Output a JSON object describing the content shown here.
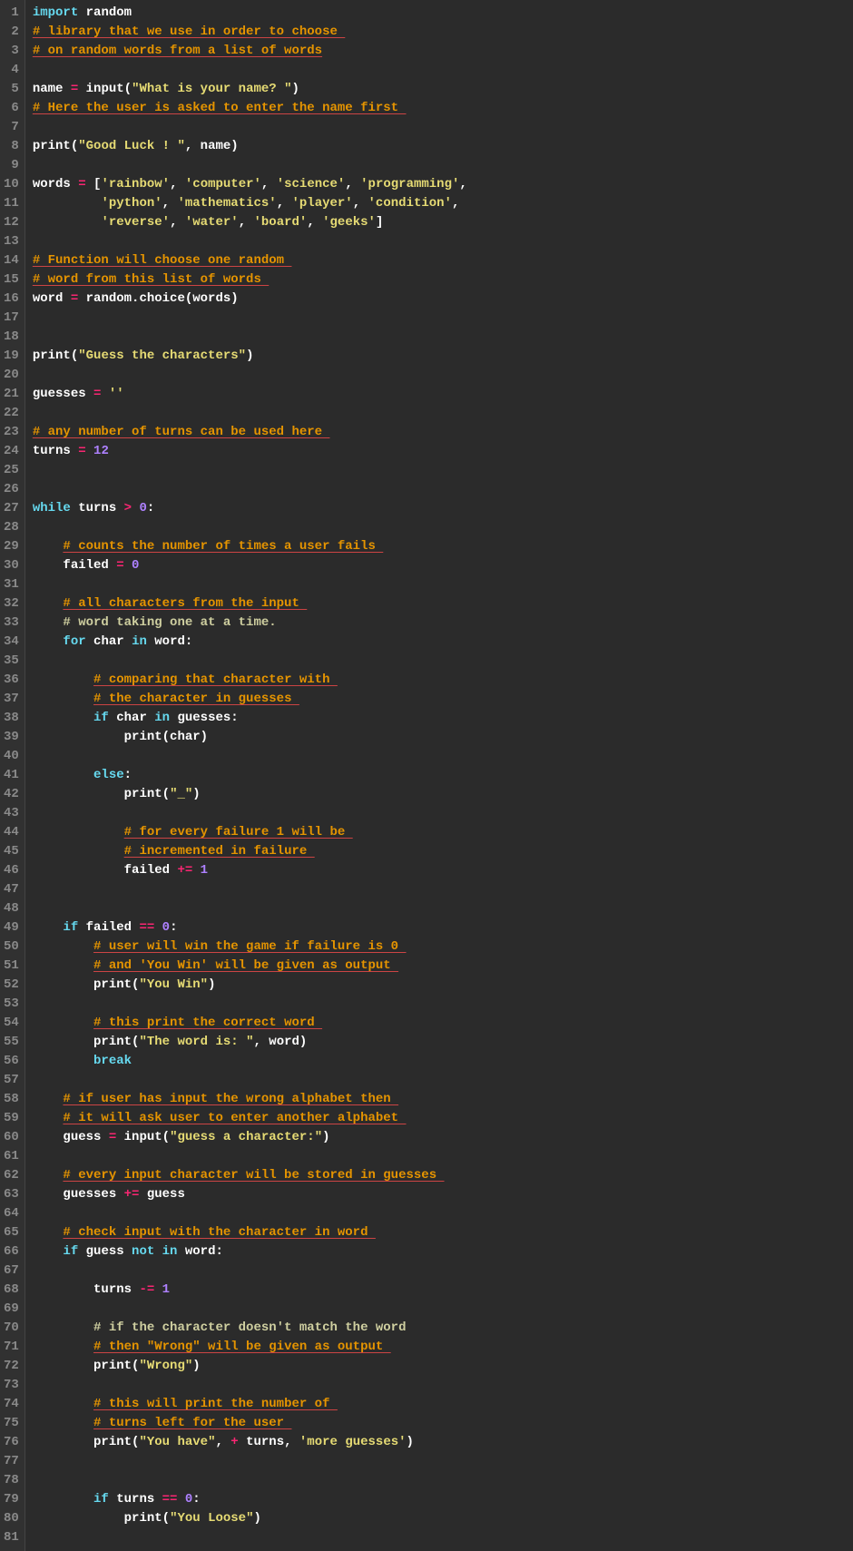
{
  "chart_data": null,
  "file": {
    "language": "python",
    "lines": [
      [
        [
          "kw",
          "import"
        ],
        [
          "nm",
          " random"
        ]
      ],
      [
        [
          "sp",
          "# library that we use in order to choose "
        ]
      ],
      [
        [
          "sp",
          "# on random words from a list of words"
        ]
      ],
      [],
      [
        [
          "nm",
          "name "
        ],
        [
          "op",
          "="
        ],
        [
          "nm",
          " "
        ],
        [
          "fn",
          "input"
        ],
        [
          "nm",
          "("
        ],
        [
          "str",
          "\"What is your name? \""
        ],
        [
          "nm",
          ")"
        ]
      ],
      [
        [
          "sp",
          "# Here the user is asked to enter the name first "
        ]
      ],
      [],
      [
        [
          "fn",
          "print"
        ],
        [
          "nm",
          "("
        ],
        [
          "str",
          "\"Good Luck ! \""
        ],
        [
          "nm",
          ", name)"
        ]
      ],
      [],
      [
        [
          "nm",
          "words "
        ],
        [
          "op",
          "="
        ],
        [
          "nm",
          " ["
        ],
        [
          "str",
          "'rainbow'"
        ],
        [
          "nm",
          ", "
        ],
        [
          "str",
          "'computer'"
        ],
        [
          "nm",
          ", "
        ],
        [
          "str",
          "'science'"
        ],
        [
          "nm",
          ", "
        ],
        [
          "str",
          "'programming'"
        ],
        [
          "nm",
          ", "
        ]
      ],
      [
        [
          "nm",
          "         "
        ],
        [
          "str",
          "'python'"
        ],
        [
          "nm",
          ", "
        ],
        [
          "str",
          "'mathematics'"
        ],
        [
          "nm",
          ", "
        ],
        [
          "str",
          "'player'"
        ],
        [
          "nm",
          ", "
        ],
        [
          "str",
          "'condition'"
        ],
        [
          "nm",
          ", "
        ]
      ],
      [
        [
          "nm",
          "         "
        ],
        [
          "str",
          "'reverse'"
        ],
        [
          "nm",
          ", "
        ],
        [
          "str",
          "'water'"
        ],
        [
          "nm",
          ", "
        ],
        [
          "str",
          "'board'"
        ],
        [
          "nm",
          ", "
        ],
        [
          "str",
          "'geeks'"
        ],
        [
          "nm",
          "] "
        ]
      ],
      [],
      [
        [
          "sp",
          "# Function will choose one random "
        ]
      ],
      [
        [
          "sp",
          "# word from this list of words "
        ]
      ],
      [
        [
          "nm",
          "word "
        ],
        [
          "op",
          "="
        ],
        [
          "nm",
          " random.choice(words) "
        ]
      ],
      [],
      [],
      [
        [
          "fn",
          "print"
        ],
        [
          "nm",
          "("
        ],
        [
          "str",
          "\"Guess the characters\""
        ],
        [
          "nm",
          ") "
        ]
      ],
      [],
      [
        [
          "nm",
          "guesses "
        ],
        [
          "op",
          "="
        ],
        [
          "nm",
          " "
        ],
        [
          "str",
          "''"
        ]
      ],
      [],
      [
        [
          "sp",
          "# any number of turns can be used here "
        ]
      ],
      [
        [
          "nm",
          "turns "
        ],
        [
          "op",
          "="
        ],
        [
          "nm",
          " "
        ],
        [
          "num",
          "12"
        ]
      ],
      [],
      [],
      [
        [
          "kw",
          "while"
        ],
        [
          "nm",
          " turns "
        ],
        [
          "op",
          ">"
        ],
        [
          "nm",
          " "
        ],
        [
          "num",
          "0"
        ],
        [
          "nm",
          ": "
        ]
      ],
      [],
      [
        [
          "nm",
          "    "
        ],
        [
          "sp",
          "# counts the number of times a user fails "
        ]
      ],
      [
        [
          "nm",
          "    failed "
        ],
        [
          "op",
          "="
        ],
        [
          "nm",
          " "
        ],
        [
          "num",
          "0"
        ]
      ],
      [],
      [
        [
          "nm",
          "    "
        ],
        [
          "sp",
          "# all characters from the input "
        ]
      ],
      [
        [
          "nm",
          "    "
        ],
        [
          "cmt",
          "# word taking one at a time. "
        ]
      ],
      [
        [
          "nm",
          "    "
        ],
        [
          "kw",
          "for"
        ],
        [
          "nm",
          " char "
        ],
        [
          "kw",
          "in"
        ],
        [
          "nm",
          " word: "
        ]
      ],
      [],
      [
        [
          "nm",
          "        "
        ],
        [
          "sp",
          "# comparing that character with "
        ]
      ],
      [
        [
          "nm",
          "        "
        ],
        [
          "sp",
          "# the character in guesses "
        ]
      ],
      [
        [
          "nm",
          "        "
        ],
        [
          "kw",
          "if"
        ],
        [
          "nm",
          " char "
        ],
        [
          "kw",
          "in"
        ],
        [
          "nm",
          " guesses: "
        ]
      ],
      [
        [
          "nm",
          "            "
        ],
        [
          "fn",
          "print"
        ],
        [
          "nm",
          "(char) "
        ]
      ],
      [],
      [
        [
          "nm",
          "        "
        ],
        [
          "kw",
          "else"
        ],
        [
          "nm",
          ": "
        ]
      ],
      [
        [
          "nm",
          "            "
        ],
        [
          "fn",
          "print"
        ],
        [
          "nm",
          "("
        ],
        [
          "str",
          "\"_\""
        ],
        [
          "nm",
          ") "
        ]
      ],
      [],
      [
        [
          "nm",
          "            "
        ],
        [
          "sp",
          "# for every failure 1 will be "
        ]
      ],
      [
        [
          "nm",
          "            "
        ],
        [
          "sp",
          "# incremented in failure "
        ]
      ],
      [
        [
          "nm",
          "            failed "
        ],
        [
          "op",
          "+="
        ],
        [
          "nm",
          " "
        ],
        [
          "num",
          "1"
        ]
      ],
      [],
      [],
      [
        [
          "nm",
          "    "
        ],
        [
          "kw",
          "if"
        ],
        [
          "nm",
          " failed "
        ],
        [
          "op",
          "=="
        ],
        [
          "nm",
          " "
        ],
        [
          "num",
          "0"
        ],
        [
          "nm",
          ": "
        ]
      ],
      [
        [
          "nm",
          "        "
        ],
        [
          "sp",
          "# user will win the game if failure is 0 "
        ]
      ],
      [
        [
          "nm",
          "        "
        ],
        [
          "sp",
          "# and 'You Win' will be given as output "
        ]
      ],
      [
        [
          "nm",
          "        "
        ],
        [
          "fn",
          "print"
        ],
        [
          "nm",
          "("
        ],
        [
          "str",
          "\"You Win\""
        ],
        [
          "nm",
          ") "
        ]
      ],
      [],
      [
        [
          "nm",
          "        "
        ],
        [
          "sp",
          "# this print the correct word "
        ]
      ],
      [
        [
          "nm",
          "        "
        ],
        [
          "fn",
          "print"
        ],
        [
          "nm",
          "("
        ],
        [
          "str",
          "\"The word is: \""
        ],
        [
          "nm",
          ", word) "
        ]
      ],
      [
        [
          "nm",
          "        "
        ],
        [
          "kw",
          "break"
        ]
      ],
      [],
      [
        [
          "nm",
          "    "
        ],
        [
          "sp",
          "# if user has input the wrong alphabet then "
        ]
      ],
      [
        [
          "nm",
          "    "
        ],
        [
          "sp",
          "# it will ask user to enter another alphabet "
        ]
      ],
      [
        [
          "nm",
          "    guess "
        ],
        [
          "op",
          "="
        ],
        [
          "nm",
          " "
        ],
        [
          "fn",
          "input"
        ],
        [
          "nm",
          "("
        ],
        [
          "str",
          "\"guess a character:\""
        ],
        [
          "nm",
          ") "
        ]
      ],
      [],
      [
        [
          "nm",
          "    "
        ],
        [
          "sp",
          "# every input character will be stored in guesses "
        ]
      ],
      [
        [
          "nm",
          "    guesses "
        ],
        [
          "op",
          "+="
        ],
        [
          "nm",
          " guess "
        ]
      ],
      [],
      [
        [
          "nm",
          "    "
        ],
        [
          "sp",
          "# check input with the character in word "
        ]
      ],
      [
        [
          "nm",
          "    "
        ],
        [
          "kw",
          "if"
        ],
        [
          "nm",
          " guess "
        ],
        [
          "kw",
          "not in"
        ],
        [
          "nm",
          " word: "
        ]
      ],
      [],
      [
        [
          "nm",
          "        turns "
        ],
        [
          "op",
          "-="
        ],
        [
          "nm",
          " "
        ],
        [
          "num",
          "1"
        ]
      ],
      [],
      [
        [
          "nm",
          "        "
        ],
        [
          "cmt",
          "# if the character doesn't match the word "
        ]
      ],
      [
        [
          "nm",
          "        "
        ],
        [
          "sp",
          "# then \"Wrong\" will be given as output "
        ]
      ],
      [
        [
          "nm",
          "        "
        ],
        [
          "fn",
          "print"
        ],
        [
          "nm",
          "("
        ],
        [
          "str",
          "\"Wrong\""
        ],
        [
          "nm",
          ") "
        ]
      ],
      [],
      [
        [
          "nm",
          "        "
        ],
        [
          "sp",
          "# this will print the number of "
        ]
      ],
      [
        [
          "nm",
          "        "
        ],
        [
          "sp",
          "# turns left for the user "
        ]
      ],
      [
        [
          "nm",
          "        "
        ],
        [
          "fn",
          "print"
        ],
        [
          "nm",
          "("
        ],
        [
          "str",
          "\"You have\""
        ],
        [
          "nm",
          ", "
        ],
        [
          "op",
          "+"
        ],
        [
          "nm",
          " turns, "
        ],
        [
          "str",
          "'more guesses'"
        ],
        [
          "nm",
          ") "
        ]
      ],
      [],
      [],
      [
        [
          "nm",
          "        "
        ],
        [
          "kw",
          "if"
        ],
        [
          "nm",
          " turns "
        ],
        [
          "op",
          "=="
        ],
        [
          "nm",
          " "
        ],
        [
          "num",
          "0"
        ],
        [
          "nm",
          ": "
        ]
      ],
      [
        [
          "nm",
          "            "
        ],
        [
          "fn",
          "print"
        ],
        [
          "nm",
          "("
        ],
        [
          "str",
          "\"You Loose\""
        ],
        [
          "nm",
          ") "
        ]
      ],
      []
    ]
  }
}
